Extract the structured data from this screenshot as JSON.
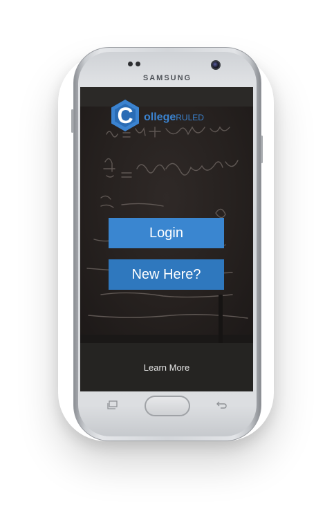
{
  "device": {
    "brand": "SAMSUNG"
  },
  "app": {
    "logo": {
      "letter": "C",
      "word_bold": "ollege",
      "word_light": "RULED"
    },
    "buttons": {
      "login": "Login",
      "new_here": "New Here?"
    },
    "learn_more": "Learn More"
  },
  "colors": {
    "accent": "#3a86d0",
    "accent_dark": "#2f78be",
    "logo_blue": "#3b83d0"
  },
  "icons": {
    "recent_apps": "recent-apps-icon",
    "back": "back-icon"
  }
}
